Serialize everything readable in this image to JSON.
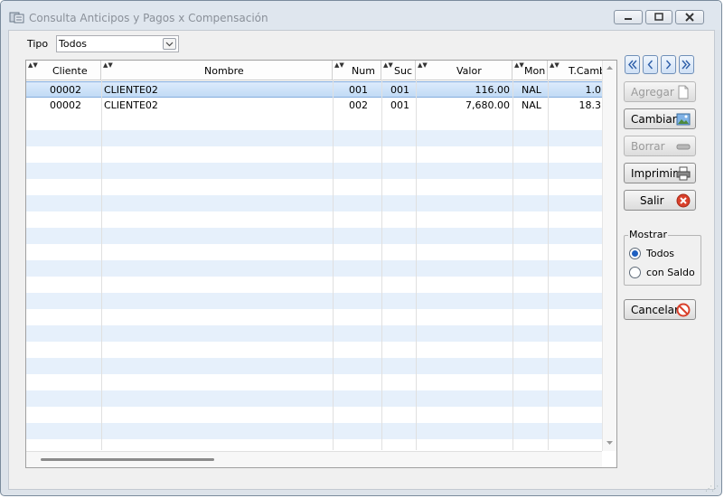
{
  "window": {
    "title": "Consulta Anticipos y Pagos x Compensación"
  },
  "filter": {
    "label": "Tipo",
    "value": "Todos"
  },
  "table": {
    "columns": [
      "Cliente",
      "Nombre",
      "Num",
      "Suc",
      "Valor",
      "Mon",
      "T.Camb"
    ],
    "rows": [
      [
        "00002",
        "CLIENTE02",
        "001",
        "001",
        "116.00",
        "NAL",
        "1.0"
      ],
      [
        "00002",
        "CLIENTE02",
        "002",
        "001",
        "7,680.00",
        "NAL",
        "18.3"
      ]
    ]
  },
  "buttons": {
    "agregar": "Agregar",
    "cambiar": "Cambiar",
    "borrar": "Borrar",
    "imprimir": "Imprimir",
    "salir": "Salir",
    "cancelar": "Cancelar"
  },
  "mostrar": {
    "title": "Mostrar",
    "options": [
      "Todos",
      "con Saldo"
    ],
    "selected": "Todos"
  },
  "colors": {
    "selection": "#c1dbf5",
    "alt_row": "#e6f0fb",
    "salir_icon": "#d9402b"
  }
}
